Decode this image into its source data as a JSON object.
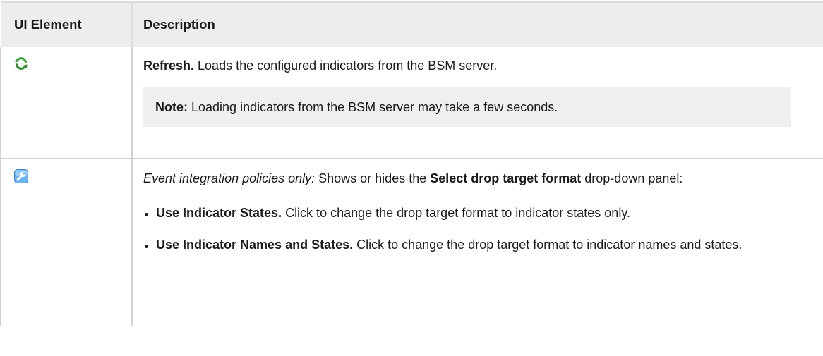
{
  "table": {
    "header": {
      "col1": "UI Element",
      "col2": "Description"
    },
    "rows": [
      {
        "icon": "refresh-icon",
        "title": "Refresh.",
        "text": " Loads the configured indicators from the BSM server.",
        "note_label": "Note:",
        "note_text": " Loading indicators from the BSM server may take a few seconds."
      },
      {
        "icon": "wrench-icon",
        "intro_italic": "Event integration policies only:",
        "intro_text": " Shows or hides the ",
        "intro_bold": "Select drop target format",
        "intro_tail": " drop-down panel:",
        "options": [
          {
            "title": "Use Indicator States.",
            "text": " Click to change the drop target format to indicator states only."
          },
          {
            "title": "Use Indicator Names and States.",
            "text": " Click to change the drop target format to indicator names and states."
          }
        ]
      }
    ]
  },
  "colors": {
    "header_bg": "#ededed",
    "note_bg": "#efefef",
    "refresh_green": "#3fa53a",
    "wrench_blue": "#4f9fe0"
  }
}
